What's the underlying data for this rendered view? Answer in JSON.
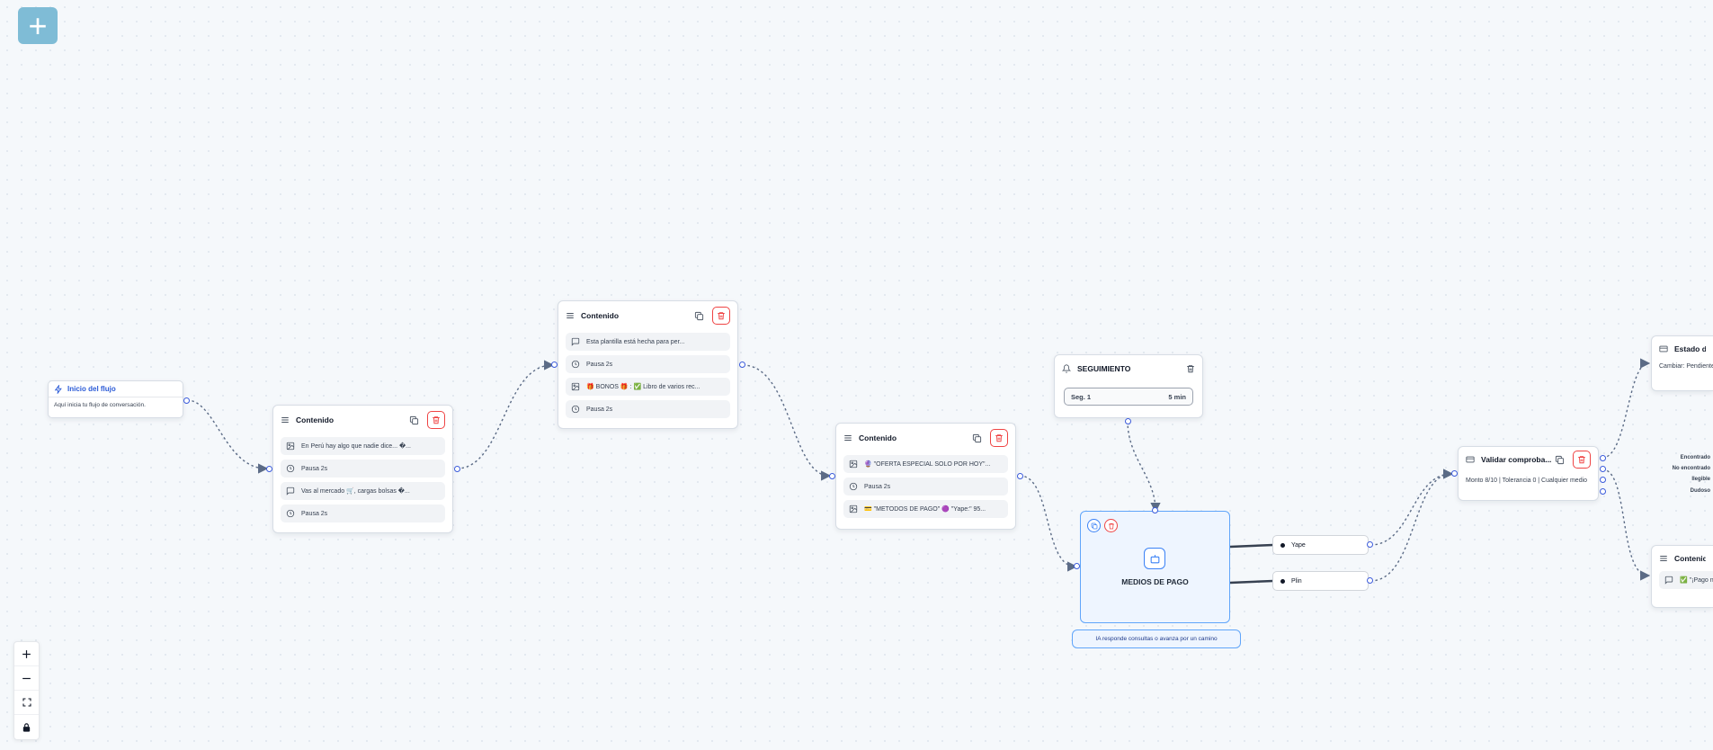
{
  "toolbar": {
    "add_label": "+"
  },
  "start_node": {
    "title": "Inicio del flujo",
    "description": "Aquí inicia tu flujo de conversación."
  },
  "content_nodes": [
    {
      "title": "Contenido",
      "items": [
        {
          "icon": "image-icon",
          "text": "En Perú hay algo que nadie dice... �..."
        },
        {
          "icon": "clock-icon",
          "text": "Pausa 2s"
        },
        {
          "icon": "message-icon",
          "text": "Vas al mercado 🛒, cargas bolsas �..."
        },
        {
          "icon": "clock-icon",
          "text": "Pausa 2s"
        }
      ]
    },
    {
      "title": "Contenido",
      "items": [
        {
          "icon": "message-icon",
          "text": "Esta plantilla está hecha para per..."
        },
        {
          "icon": "clock-icon",
          "text": "Pausa 2s"
        },
        {
          "icon": "image-icon",
          "text": "🎁 BONOS 🎁 : ✅ Libro de varios rec..."
        },
        {
          "icon": "clock-icon",
          "text": "Pausa 2s"
        }
      ]
    },
    {
      "title": "Contenido",
      "items": [
        {
          "icon": "image-icon",
          "text": "🔮 \"OFERTA ESPECIAL SOLO POR HOY\"..."
        },
        {
          "icon": "clock-icon",
          "text": "Pausa 2s"
        },
        {
          "icon": "image-icon",
          "text": "💳 \"METODOS DE PAGO\" 🟣 \"Yape:\" 95..."
        }
      ]
    }
  ],
  "followup_node": {
    "title": "SEGUIMIENTO",
    "segment_label": "Seg. 1",
    "segment_time": "5 min"
  },
  "agent_node": {
    "title": "MEDIOS DE PAGO",
    "description": "IA responde consultas o avanza por un camino",
    "paths": [
      "Yape",
      "Plin"
    ]
  },
  "validate_node": {
    "title": "Validar comproba...",
    "description": "Monto 8/10 | Tolerancia 0 | Cualquier medio",
    "outputs": [
      "Encontrado",
      "No encontrado",
      "Ilegible",
      "Dudoso"
    ]
  },
  "status_node": {
    "title": "Estado de p",
    "description": "Cambiar: Pendiente"
  },
  "partial_content_node": {
    "title": "Contenido",
    "item_text": "✅ \"¡Pago no c"
  },
  "zoom_controls": [
    "zoom-in",
    "zoom-out",
    "fit-view",
    "lock"
  ],
  "colors": {
    "accent": "#3b5bdb",
    "danger": "#ef4444",
    "add_button": "#7fbcd6",
    "agent_border": "#60a5fa"
  }
}
